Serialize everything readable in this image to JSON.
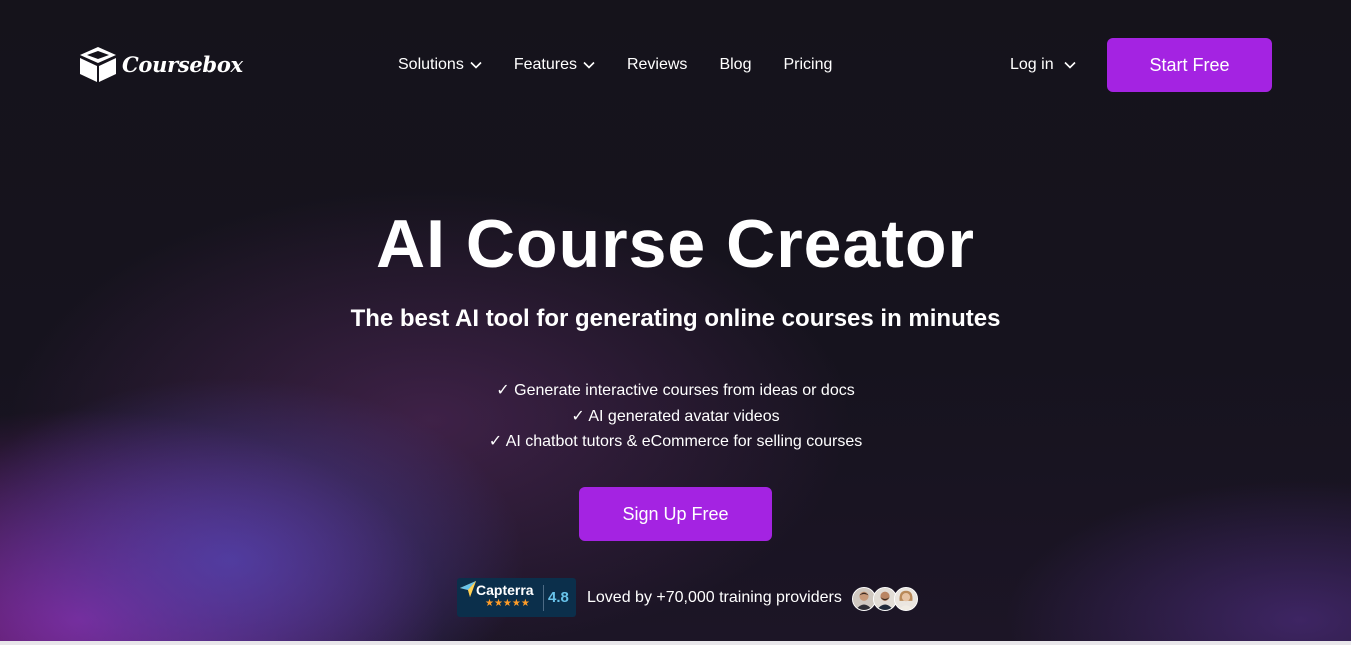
{
  "brand": {
    "name": "Coursebox",
    "logo_icon": "open-box-icon"
  },
  "nav": {
    "items": [
      {
        "label": "Solutions",
        "has_dropdown": true
      },
      {
        "label": "Features",
        "has_dropdown": true
      },
      {
        "label": "Reviews",
        "has_dropdown": false
      },
      {
        "label": "Blog",
        "has_dropdown": false
      },
      {
        "label": "Pricing",
        "has_dropdown": false
      }
    ],
    "login_label": "Log in",
    "cta_label": "Start Free"
  },
  "hero": {
    "title": "AI Course Creator",
    "subtitle": "The best AI tool for generating online courses in minutes",
    "features": [
      "✓ Generate interactive courses from ideas or docs",
      "✓ AI generated avatar videos",
      "✓ AI chatbot tutors & eCommerce for selling courses"
    ],
    "cta_label": "Sign Up Free"
  },
  "social_proof": {
    "badge_name": "Capterra",
    "badge_stars": "★★★★★",
    "badge_score": "4.8",
    "text": "Loved by +70,000 training providers",
    "avatar_icons": [
      "user-avatar-1",
      "user-avatar-2",
      "user-avatar-3"
    ]
  },
  "colors": {
    "accent": "#a423e2",
    "background": "#14121a",
    "capterra_bg": "#0b2f4b",
    "capterra_score": "#68c3ea",
    "star": "#ff9d28"
  }
}
